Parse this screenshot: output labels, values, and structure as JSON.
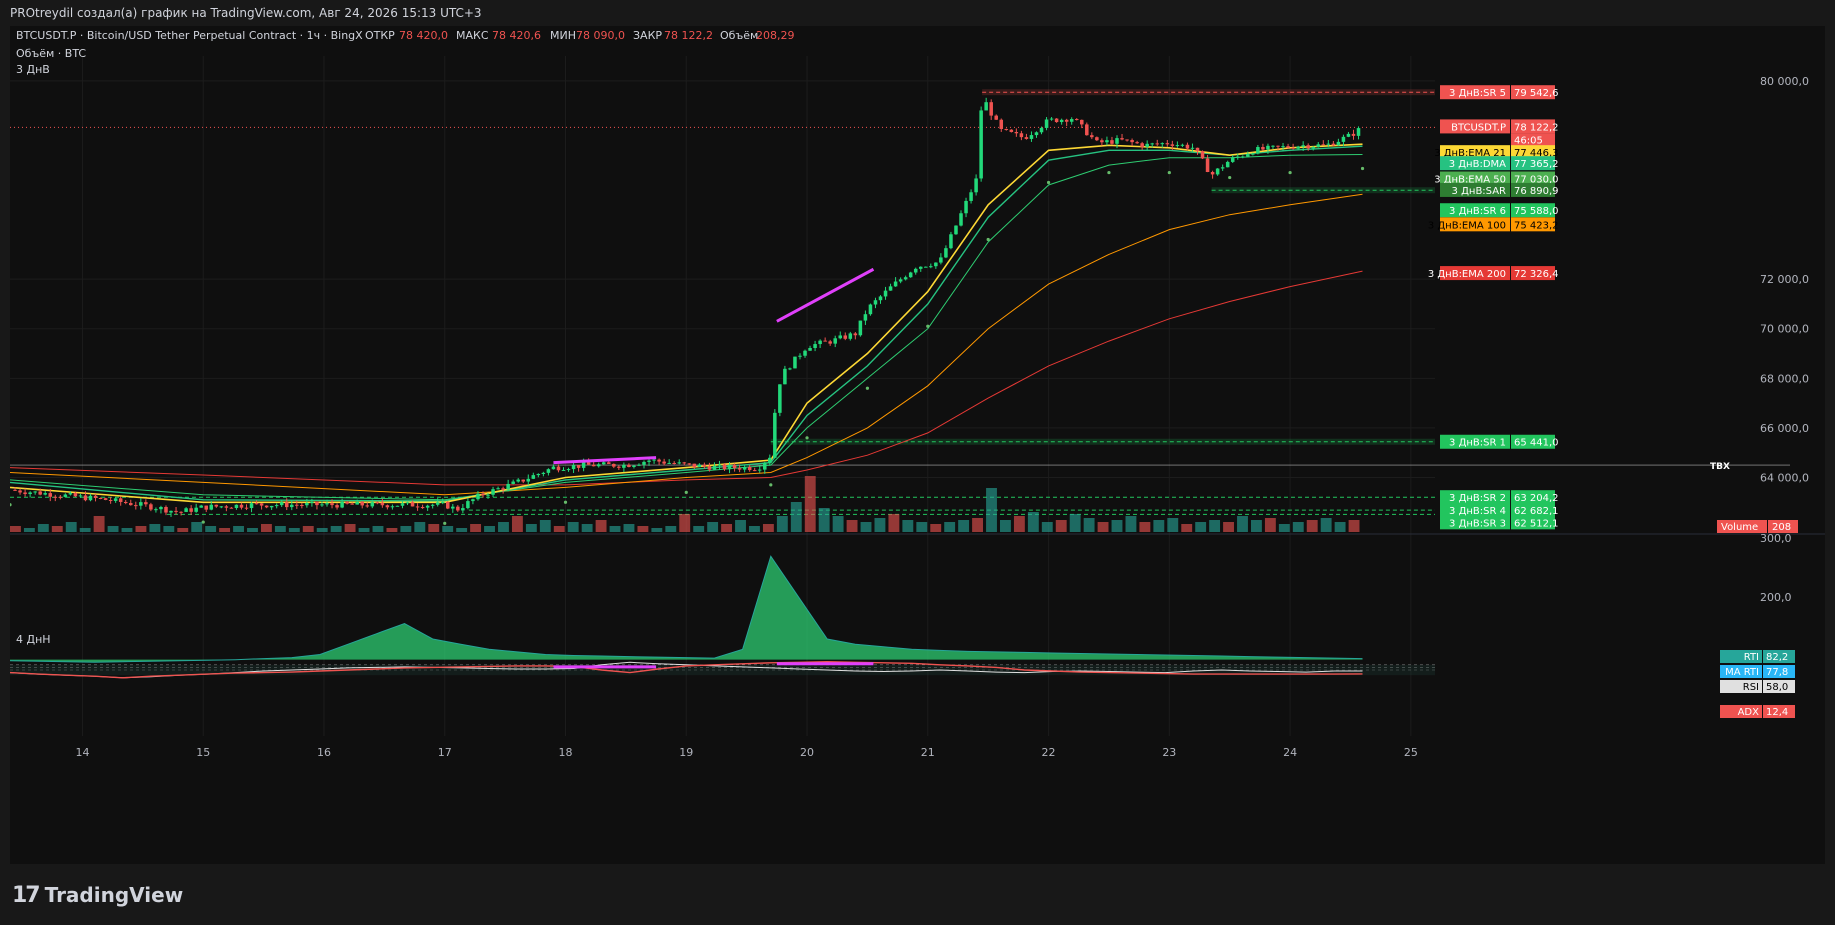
{
  "header": {
    "title": "PROtreydil создал(а) график на TradingView.com, Авг 24, 2026 15:13 UTC+3"
  },
  "symbol_line": {
    "symbol": "BTCUSDT.P · Bitcoin/USD Tether Perpetual Contract · 1ч · BingX",
    "open_label": "ОТКР",
    "open_value": "78 420,0",
    "high_label": "МАКС",
    "high_value": "78 420,6",
    "low_label": "МИН",
    "low_value": "78 090,0",
    "close_label": "ЗАКР",
    "close_value": "78 122,2",
    "volume_label": "Объём",
    "volume_value": "208,29",
    "volume_row": "Объём · BTC",
    "timeframe_note": "3 ДнВ"
  },
  "colors": {
    "up": "#22d97a",
    "down": "#ef5350",
    "ema21": "#fdd835",
    "ema50": "#2ecc71",
    "ema100": "#ff9800",
    "ema200": "#e53935",
    "dma": "#26c281",
    "sar": "#66bb6a",
    "rti": "#26a69a",
    "ma_rti": "#29b6f6",
    "rsi": "#e0e0e0",
    "adx": "#ef5350",
    "magenta": "#e040fb",
    "vol_up": "#26a69a",
    "vol_down": "#ef5350"
  },
  "price_axis": {
    "labels": [
      "80 000,0",
      "72 000,0",
      "70 000,0",
      "68 000,0",
      "66 000,0",
      "64 000,0"
    ],
    "badges": [
      {
        "name": "3 ДнВ:SR 5",
        "value": "79 542,6",
        "color": "#ef5350"
      },
      {
        "name": "BTCUSDT.P",
        "value": "78 122,2",
        "sub": "46:05",
        "color": "#ef5350"
      },
      {
        "name": "3 ДнВ:EMA 21",
        "value": "77 446,3",
        "color": "#fdd835"
      },
      {
        "name": "3 ДнВ:DMA",
        "value": "77 365,2",
        "color": "#26c281"
      },
      {
        "name": "3 ДнВ:EMA 50",
        "value": "77 030,0",
        "color": "#4caf50"
      },
      {
        "name": "3 ДнВ:SAR",
        "value": "76 890,9",
        "color": "#2e7d32"
      },
      {
        "name": "3 ДнВ:SR 6",
        "value": "75 588,0",
        "color": "#22c55e"
      },
      {
        "name": "3 ДнВ:EMA 100",
        "value": "75 423,2",
        "color": "#ff9800"
      },
      {
        "name": "3 ДнВ:EMA 200",
        "value": "72 326,4",
        "color": "#e53935"
      },
      {
        "name": "3 ДнВ:SR 1",
        "value": "65 441,0",
        "color": "#22c55e"
      },
      {
        "name": "3 ДнВ:SR 2",
        "value": "63 204,2",
        "color": "#22c55e"
      },
      {
        "name": "3 ДнВ:SR 4",
        "value": "62 682,1",
        "color": "#22c55e"
      },
      {
        "name": "3 ДнВ:SR 3",
        "value": "62 512,1",
        "color": "#22c55e"
      }
    ],
    "tbx_label": "ТВХ",
    "volume_badge": {
      "name": "Volume",
      "value": "208"
    }
  },
  "oscillator": {
    "title": "4 ДнН",
    "axis_labels": [
      "300,0",
      "200,0"
    ],
    "badges": [
      {
        "name": "RTI",
        "value": "82,2",
        "color": "#26a69a"
      },
      {
        "name": "MA RTI",
        "value": "77,8",
        "color": "#29b6f6"
      },
      {
        "name": "RSI",
        "value": "58,0",
        "color": "#e0e0e0"
      },
      {
        "name": "ADX",
        "value": "12,4",
        "color": "#ef5350"
      }
    ]
  },
  "time_axis": {
    "labels": [
      "14",
      "15",
      "16",
      "17",
      "18",
      "19",
      "20",
      "21",
      "22",
      "23",
      "24",
      "25"
    ]
  },
  "chart_data": {
    "type": "line",
    "title": "BTCUSDT.P · Bitcoin/USD Tether Perpetual Contract · 1ч · BingX",
    "x_unit": "day of month (Aug 2026)",
    "xlim": [
      13.4,
      25.2
    ],
    "ylim": [
      61800,
      80600
    ],
    "price_path": [
      [
        13.4,
        63500
      ],
      [
        13.8,
        63300
      ],
      [
        14.2,
        63100
      ],
      [
        14.6,
        62800
      ],
      [
        14.8,
        62600
      ],
      [
        15.0,
        62800
      ],
      [
        15.4,
        62900
      ],
      [
        15.8,
        62900
      ],
      [
        16.2,
        62900
      ],
      [
        16.6,
        62900
      ],
      [
        17.0,
        62900
      ],
      [
        17.1,
        62700
      ],
      [
        17.3,
        63300
      ],
      [
        17.6,
        63800
      ],
      [
        17.9,
        64400
      ],
      [
        18.2,
        64500
      ],
      [
        18.5,
        64500
      ],
      [
        18.7,
        64700
      ],
      [
        19.0,
        64500
      ],
      [
        19.3,
        64400
      ],
      [
        19.6,
        64400
      ],
      [
        19.7,
        64900
      ],
      [
        19.75,
        67500
      ],
      [
        19.8,
        68200
      ],
      [
        20.0,
        69300
      ],
      [
        20.2,
        69500
      ],
      [
        20.4,
        69800
      ],
      [
        20.5,
        70800
      ],
      [
        20.7,
        71700
      ],
      [
        20.9,
        72500
      ],
      [
        21.1,
        72700
      ],
      [
        21.2,
        73800
      ],
      [
        21.4,
        76000
      ],
      [
        21.45,
        79400
      ],
      [
        21.6,
        78000
      ],
      [
        21.8,
        77700
      ],
      [
        22.0,
        78400
      ],
      [
        22.2,
        78500
      ],
      [
        22.4,
        77500
      ],
      [
        22.6,
        77600
      ],
      [
        22.8,
        77400
      ],
      [
        23.0,
        77500
      ],
      [
        23.2,
        77300
      ],
      [
        23.35,
        76200
      ],
      [
        23.5,
        76800
      ],
      [
        23.7,
        77200
      ],
      [
        23.9,
        77300
      ],
      [
        24.1,
        77400
      ],
      [
        24.3,
        77400
      ],
      [
        24.5,
        77800
      ],
      [
        24.6,
        78122
      ]
    ],
    "series": [
      {
        "name": "3 ДнВ:EMA 21",
        "last": 77446.3
      },
      {
        "name": "3 ДнВ:DMA",
        "last": 77365.2
      },
      {
        "name": "3 ДнВ:EMA 50",
        "last": 77030.0
      },
      {
        "name": "3 ДнВ:SAR",
        "last": 76890.9
      },
      {
        "name": "3 ДнВ:EMA 100",
        "last": 75423.2
      },
      {
        "name": "3 ДнВ:EMA 200",
        "last": 72326.4
      }
    ],
    "ema21": [
      [
        13.4,
        63600
      ],
      [
        15,
        63000
      ],
      [
        17,
        63000
      ],
      [
        18,
        64000
      ],
      [
        19,
        64400
      ],
      [
        19.7,
        64700
      ],
      [
        20,
        67000
      ],
      [
        20.5,
        69000
      ],
      [
        21,
        71500
      ],
      [
        21.5,
        75000
      ],
      [
        22,
        77200
      ],
      [
        22.5,
        77400
      ],
      [
        23,
        77300
      ],
      [
        23.5,
        77000
      ],
      [
        24,
        77300
      ],
      [
        24.6,
        77446
      ]
    ],
    "ema50": [
      [
        13.4,
        63900
      ],
      [
        15,
        63300
      ],
      [
        17,
        63100
      ],
      [
        18,
        63800
      ],
      [
        19,
        64200
      ],
      [
        19.7,
        64500
      ],
      [
        20,
        66000
      ],
      [
        20.5,
        68000
      ],
      [
        21,
        70000
      ],
      [
        21.5,
        73500
      ],
      [
        22,
        75800
      ],
      [
        22.5,
        76600
      ],
      [
        23,
        76900
      ],
      [
        23.5,
        76900
      ],
      [
        24,
        77000
      ],
      [
        24.6,
        77030
      ]
    ],
    "dma": [
      [
        13.4,
        63800
      ],
      [
        15,
        63100
      ],
      [
        17,
        63050
      ],
      [
        18,
        63900
      ],
      [
        19,
        64300
      ],
      [
        19.7,
        64600
      ],
      [
        20,
        66500
      ],
      [
        20.5,
        68500
      ],
      [
        21,
        71000
      ],
      [
        21.5,
        74500
      ],
      [
        22,
        76800
      ],
      [
        22.5,
        77200
      ],
      [
        23,
        77200
      ],
      [
        23.5,
        77000
      ],
      [
        24,
        77200
      ],
      [
        24.6,
        77365
      ]
    ],
    "ema100": [
      [
        13.4,
        64200
      ],
      [
        15,
        63800
      ],
      [
        17,
        63300
      ],
      [
        18,
        63600
      ],
      [
        19,
        64000
      ],
      [
        19.7,
        64200
      ],
      [
        20,
        64800
      ],
      [
        20.5,
        66000
      ],
      [
        21,
        67700
      ],
      [
        21.5,
        70000
      ],
      [
        22,
        71800
      ],
      [
        22.5,
        73000
      ],
      [
        23,
        74000
      ],
      [
        23.5,
        74600
      ],
      [
        24,
        75000
      ],
      [
        24.6,
        75423
      ]
    ],
    "ema200": [
      [
        13.4,
        64400
      ],
      [
        15,
        64100
      ],
      [
        17,
        63700
      ],
      [
        18,
        63700
      ],
      [
        19,
        63900
      ],
      [
        19.7,
        64000
      ],
      [
        20,
        64300
      ],
      [
        20.5,
        64900
      ],
      [
        21,
        65800
      ],
      [
        21.5,
        67200
      ],
      [
        22,
        68500
      ],
      [
        22.5,
        69500
      ],
      [
        23,
        70400
      ],
      [
        23.5,
        71100
      ],
      [
        24,
        71700
      ],
      [
        24.6,
        72326
      ]
    ],
    "sr_levels": [
      {
        "name": "SR 5",
        "value": 79542.6,
        "from": 21.45
      },
      {
        "name": "SR 6",
        "value": 75588.0,
        "from": 23.35
      },
      {
        "name": "SR 1",
        "value": 65441.0,
        "from": 19.7
      },
      {
        "name": "SR 2",
        "value": 63204.2,
        "from": 13.4
      },
      {
        "name": "SR 4",
        "value": 62682.1,
        "from": 17.2
      },
      {
        "name": "SR 3",
        "value": 62512.1,
        "from": 14.7
      }
    ],
    "tbx": 64500,
    "last_price": 78122.2,
    "volume": [
      3,
      2,
      4,
      3,
      5,
      2,
      8,
      3,
      2,
      3,
      4,
      3,
      2,
      5,
      3,
      2,
      3,
      2,
      4,
      3,
      2,
      3,
      2,
      3,
      4,
      2,
      3,
      2,
      3,
      5,
      4,
      3,
      2,
      4,
      3,
      5,
      8,
      4,
      6,
      3,
      5,
      4,
      6,
      3,
      4,
      3,
      2,
      3,
      9,
      3,
      5,
      4,
      6,
      3,
      4,
      8,
      15,
      28,
      12,
      8,
      6,
      5,
      7,
      9,
      6,
      5,
      4,
      5,
      6,
      7,
      22,
      6,
      8,
      10,
      5,
      6,
      9,
      7,
      5,
      6,
      8,
      5,
      6,
      7,
      4,
      5,
      6,
      5,
      8,
      6,
      7,
      4,
      5,
      6,
      7,
      5,
      6
    ],
    "oscillator_rti": [
      78,
      77,
      76,
      75,
      76,
      77,
      78,
      79,
      80,
      82,
      84,
      90,
      110,
      130,
      150,
      120,
      110,
      100,
      95,
      90,
      88,
      87,
      86,
      85,
      84,
      83,
      100,
      280,
      200,
      120,
      110,
      105,
      100,
      98,
      96,
      95,
      94,
      93,
      92,
      91,
      90,
      89,
      88,
      87,
      86,
      85,
      84,
      83,
      82
    ],
    "oscillator_rsi": [
      55,
      52,
      50,
      48,
      45,
      47,
      50,
      52,
      55,
      58,
      60,
      62,
      64,
      65,
      66,
      65,
      64,
      63,
      62,
      62,
      63,
      70,
      75,
      72,
      70,
      68,
      66,
      64,
      62,
      60,
      58,
      57,
      58,
      60,
      58,
      56,
      55,
      57,
      58,
      57,
      56,
      55,
      58,
      60,
      58,
      57,
      56,
      58,
      58
    ],
    "oscillator_adx": [
      15,
      12,
      10,
      8,
      5,
      8,
      10,
      12,
      14,
      15,
      16,
      18,
      20,
      22,
      24,
      25,
      26,
      27,
      28,
      28,
      27,
      20,
      15,
      22,
      28,
      30,
      32,
      34,
      35,
      36,
      35,
      34,
      33,
      30,
      28,
      25,
      20,
      18,
      16,
      15,
      14,
      13,
      12,
      12,
      12,
      12,
      12,
      12,
      12.4
    ]
  }
}
